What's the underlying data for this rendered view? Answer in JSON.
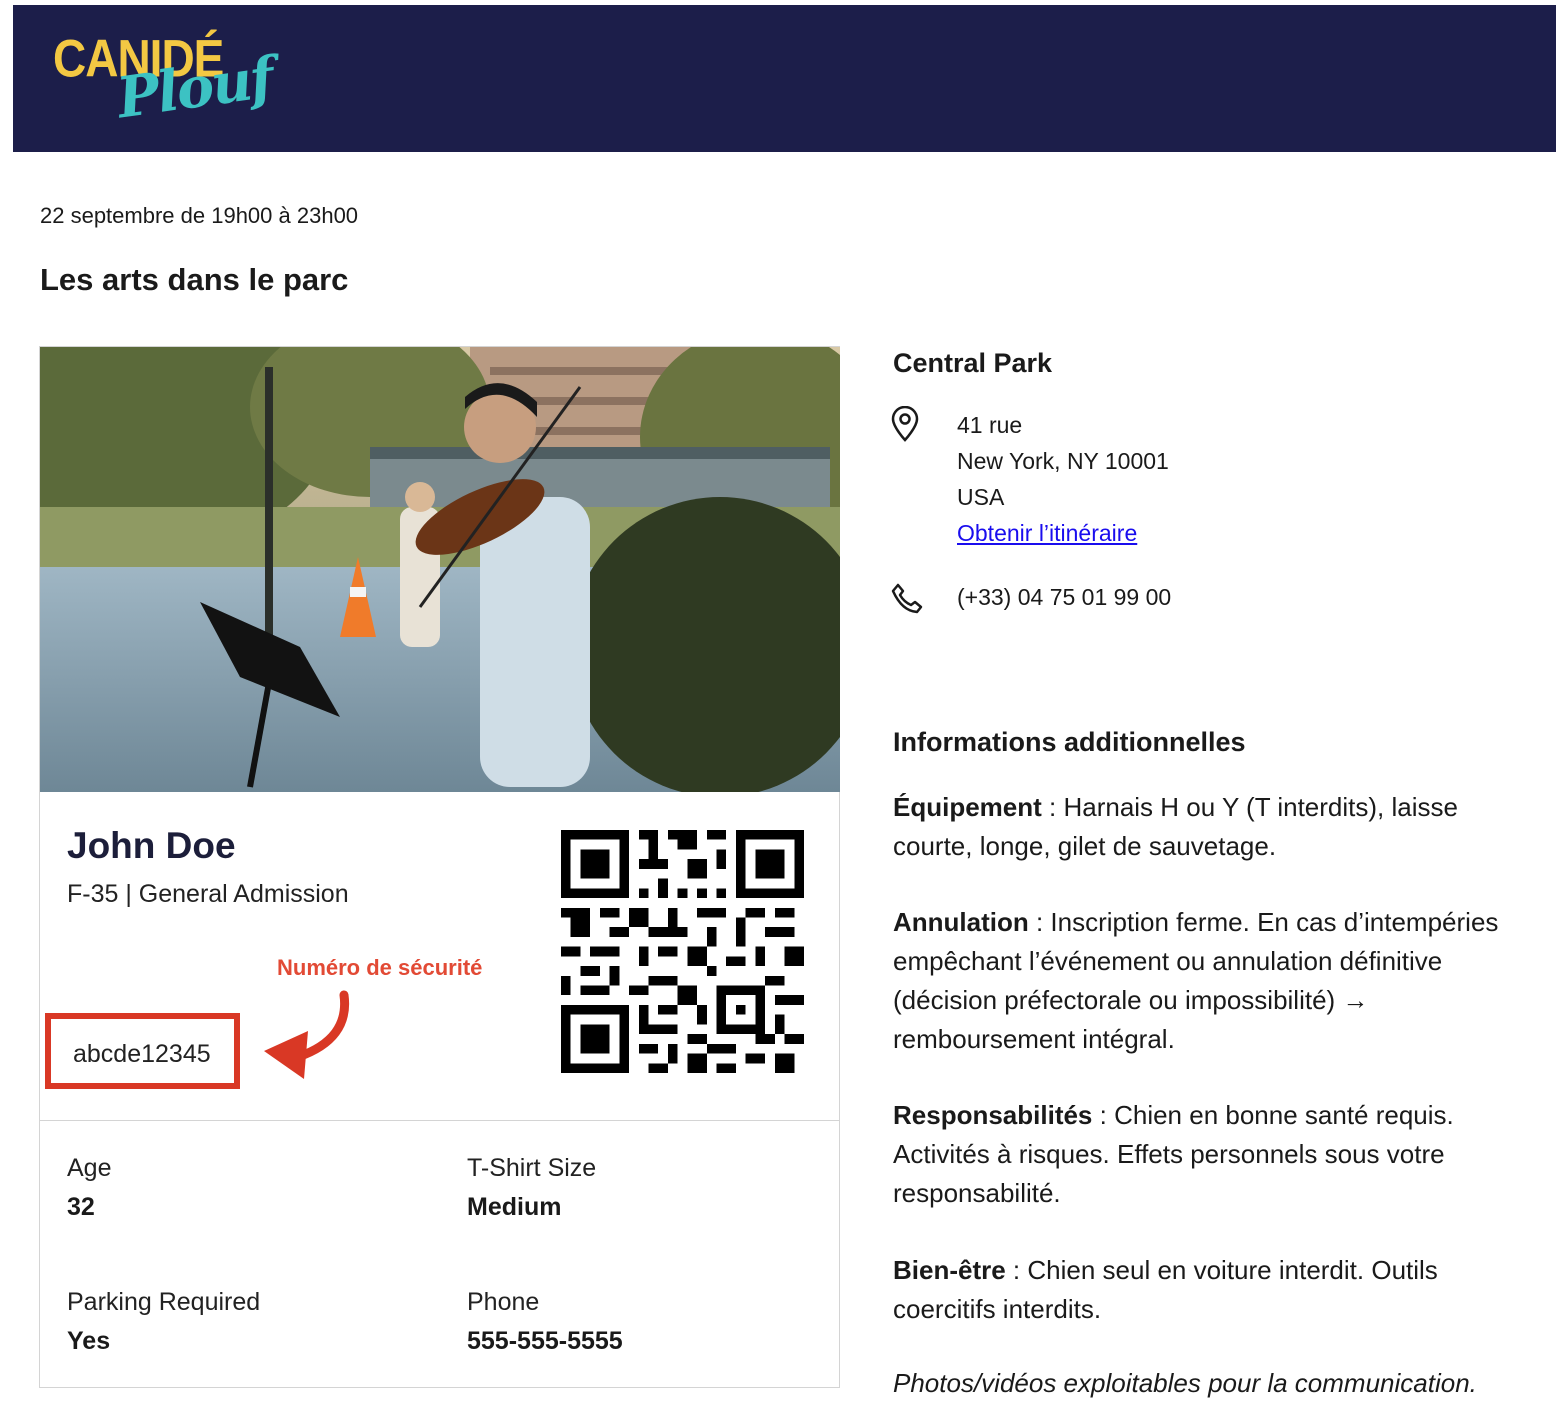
{
  "brand": {
    "logo_top": "CANIDÉ",
    "logo_bottom": "Plouf",
    "header_color": "#1c1e4a",
    "logo_yellow": "#f3c843",
    "logo_teal": "#3cc2c3"
  },
  "event": {
    "date": "22 septembre de 19h00 à 23h00",
    "title": "Les arts dans le parc"
  },
  "ticket": {
    "name": "John Doe",
    "seat": "F-35 | General Admission",
    "security_label": "Numéro de sécurité",
    "security_code": "abcde12345",
    "accent_color": "#d93825",
    "qr_icon": "qr-code",
    "fields": [
      {
        "label": "Age",
        "value": "32"
      },
      {
        "label": "T-Shirt Size",
        "value": "Medium"
      },
      {
        "label": "Parking Required",
        "value": "Yes"
      },
      {
        "label": "Phone",
        "value": "555-555-5555"
      }
    ]
  },
  "venue": {
    "name": "Central Park",
    "address": [
      "41 rue",
      "New York, NY 10001",
      "USA"
    ],
    "directions_label": "Obtenir l’itinéraire",
    "phone": "(+33) 04 75 01 99 00",
    "link_color": "#1a0dee"
  },
  "info": {
    "title": "Informations additionnelles",
    "sections": [
      {
        "term": "Équipement",
        "text": " : Harnais H ou Y (T interdits), laisse courte, longe, gilet de sauvetage."
      },
      {
        "term": "Annulation",
        "text": " : Inscription ferme. En cas d’intempéries empêchant l’événement ou annulation définitive (décision préfectorale ou impossibilité) → remboursement intégral."
      },
      {
        "term": "Responsabilités",
        "text": " : Chien en bonne santé requis. Activités à risques. Effets personnels sous votre responsabilité."
      },
      {
        "term": "Bien-être",
        "text": " : Chien seul en voiture interdit. Outils coercitifs interdits."
      }
    ],
    "note": "Photos/vidéos exploitables pour la communication."
  }
}
